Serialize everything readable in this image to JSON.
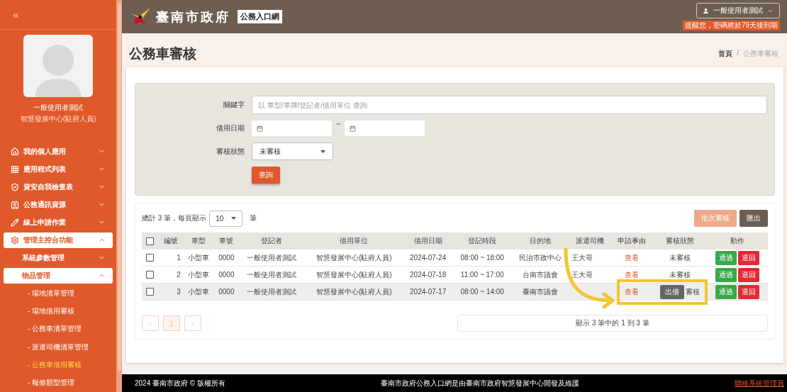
{
  "sidebar": {
    "collapse_icon": "«",
    "user_name": "一般使用者測試",
    "user_unit": "智慧發展中心(駐府人員)",
    "menu": [
      {
        "label": "我的個人應用",
        "expanded": false
      },
      {
        "label": "應用程式列表",
        "expanded": false
      },
      {
        "label": "資安自我檢查表",
        "expanded": false
      },
      {
        "label": "公務通訊資源",
        "expanded": false
      },
      {
        "label": "線上申請作業",
        "expanded": false
      },
      {
        "label": "管理主控台功能",
        "expanded": true,
        "children": [
          {
            "label": "系統參數管理",
            "expanded": false
          },
          {
            "label": "物品管理",
            "expanded": true,
            "children": [
              {
                "label": "- 場地清單管理",
                "selected": false
              },
              {
                "label": "- 場地借用審核",
                "selected": false
              },
              {
                "label": "- 公務車清單管理",
                "selected": false
              },
              {
                "label": "- 派遣司機清單管理",
                "selected": false
              },
              {
                "label": "- 公務車借用審核",
                "selected": true
              },
              {
                "label": "- 報修類型管理",
                "selected": false
              }
            ]
          }
        ]
      }
    ]
  },
  "header": {
    "site_name": "臺南市政府",
    "portal_badge": "公務入口網",
    "user_button": "一般使用者測試",
    "password_notice": "提醒您，密碼將於79天後到期"
  },
  "page": {
    "title": "公務車審核",
    "breadcrumb": [
      {
        "label": "首頁",
        "current": false
      },
      {
        "label": "公務車審核",
        "current": true
      }
    ],
    "breadcrumb_separator": "/"
  },
  "filters": {
    "keyword": {
      "label": "關鍵字",
      "placeholder": "以 車型/車牌/登記者/借用單位 查詢"
    },
    "date": {
      "label": "借用日期",
      "separator": "~"
    },
    "status": {
      "label": "審核狀態",
      "value": "未審核"
    },
    "search_button": "查詢"
  },
  "list": {
    "select_all_checked": false,
    "total_text": "總計 3 筆，每頁顯示",
    "page_size": "10",
    "unit": "筆",
    "batch_button": "批次審核",
    "export_button": "匯出",
    "columns": [
      "編號",
      "車型",
      "車號",
      "登記者",
      "借用單位",
      "借用日期",
      "登記時段",
      "目的地",
      "派遣司機",
      "申請事由",
      "審核狀態",
      "動作"
    ],
    "rows": [
      {
        "checked": false,
        "hovered": false,
        "no": "1",
        "type": "小型車",
        "plate": "0000",
        "registrant": "一般使用者測試",
        "unit": "智慧發展中心(駐府人員)",
        "date": "2024-07-24",
        "period": "08:00 ~ 18:00",
        "destination": "民治市政中心",
        "driver": "王大哥",
        "reason": "查看",
        "status": "未審核",
        "approve": "通過",
        "reject": "退回"
      },
      {
        "checked": false,
        "hovered": false,
        "no": "2",
        "type": "小型車",
        "plate": "0000",
        "registrant": "一般使用者測試",
        "unit": "智慧發展中心(駐府人員)",
        "date": "2024-07-18",
        "period": "11:00 ~ 17:00",
        "destination": "台南市議會",
        "driver": "王大哥",
        "reason": "查看",
        "status": "未審核",
        "approve": "通過",
        "reject": "退回"
      },
      {
        "checked": false,
        "hovered": true,
        "no": "3",
        "type": "小型車",
        "plate": "0000",
        "registrant": "一般使用者測試",
        "unit": "智慧發展中心(駐府人員)",
        "date": "2024-07-17",
        "period": "08:00 ~ 14:00",
        "destination": "臺南市議會",
        "reason": "查看",
        "status": "審核",
        "tooltip": "出借",
        "approve": "通過",
        "reject": "退回"
      }
    ],
    "pager": {
      "prev": "‹",
      "current": "1",
      "next": "›"
    },
    "summary": "顯示 3 筆中的 1 到 3 筆"
  },
  "footer": {
    "copyright": "2024 臺南市政府 © 版權所有",
    "credit": "臺南市政府公務入口網是由臺南市政府智慧發展中心開發及維護",
    "contact_link": "聯絡系統管理員"
  }
}
